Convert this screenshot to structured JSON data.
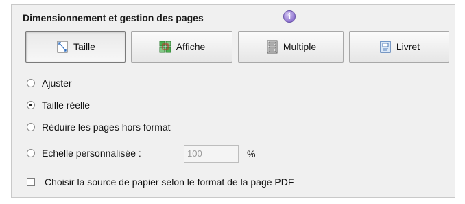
{
  "section": {
    "title": "Dimensionnement et gestion des pages",
    "info_icon": "info-icon"
  },
  "tabs": [
    {
      "label": "Taille",
      "icon": "page-size-icon",
      "active": true
    },
    {
      "label": "Affiche",
      "icon": "poster-tiles-icon",
      "active": false
    },
    {
      "label": "Multiple",
      "icon": "multiple-pages-icon",
      "active": false
    },
    {
      "label": "Livret",
      "icon": "booklet-icon",
      "active": false
    }
  ],
  "options": [
    {
      "label": "Ajuster",
      "selected": false
    },
    {
      "label": "Taille réelle",
      "selected": true
    },
    {
      "label": "Réduire les pages hors format",
      "selected": false
    },
    {
      "label": "Echelle personnalisée :",
      "selected": false
    }
  ],
  "scale": {
    "value": "100",
    "unit": "%"
  },
  "paper_source_checkbox": {
    "label": "Choisir la source de papier selon le format de la page PDF",
    "checked": false
  },
  "colors": {
    "panel_bg": "#f0f0f0",
    "info_icon": "#8f74d0"
  }
}
